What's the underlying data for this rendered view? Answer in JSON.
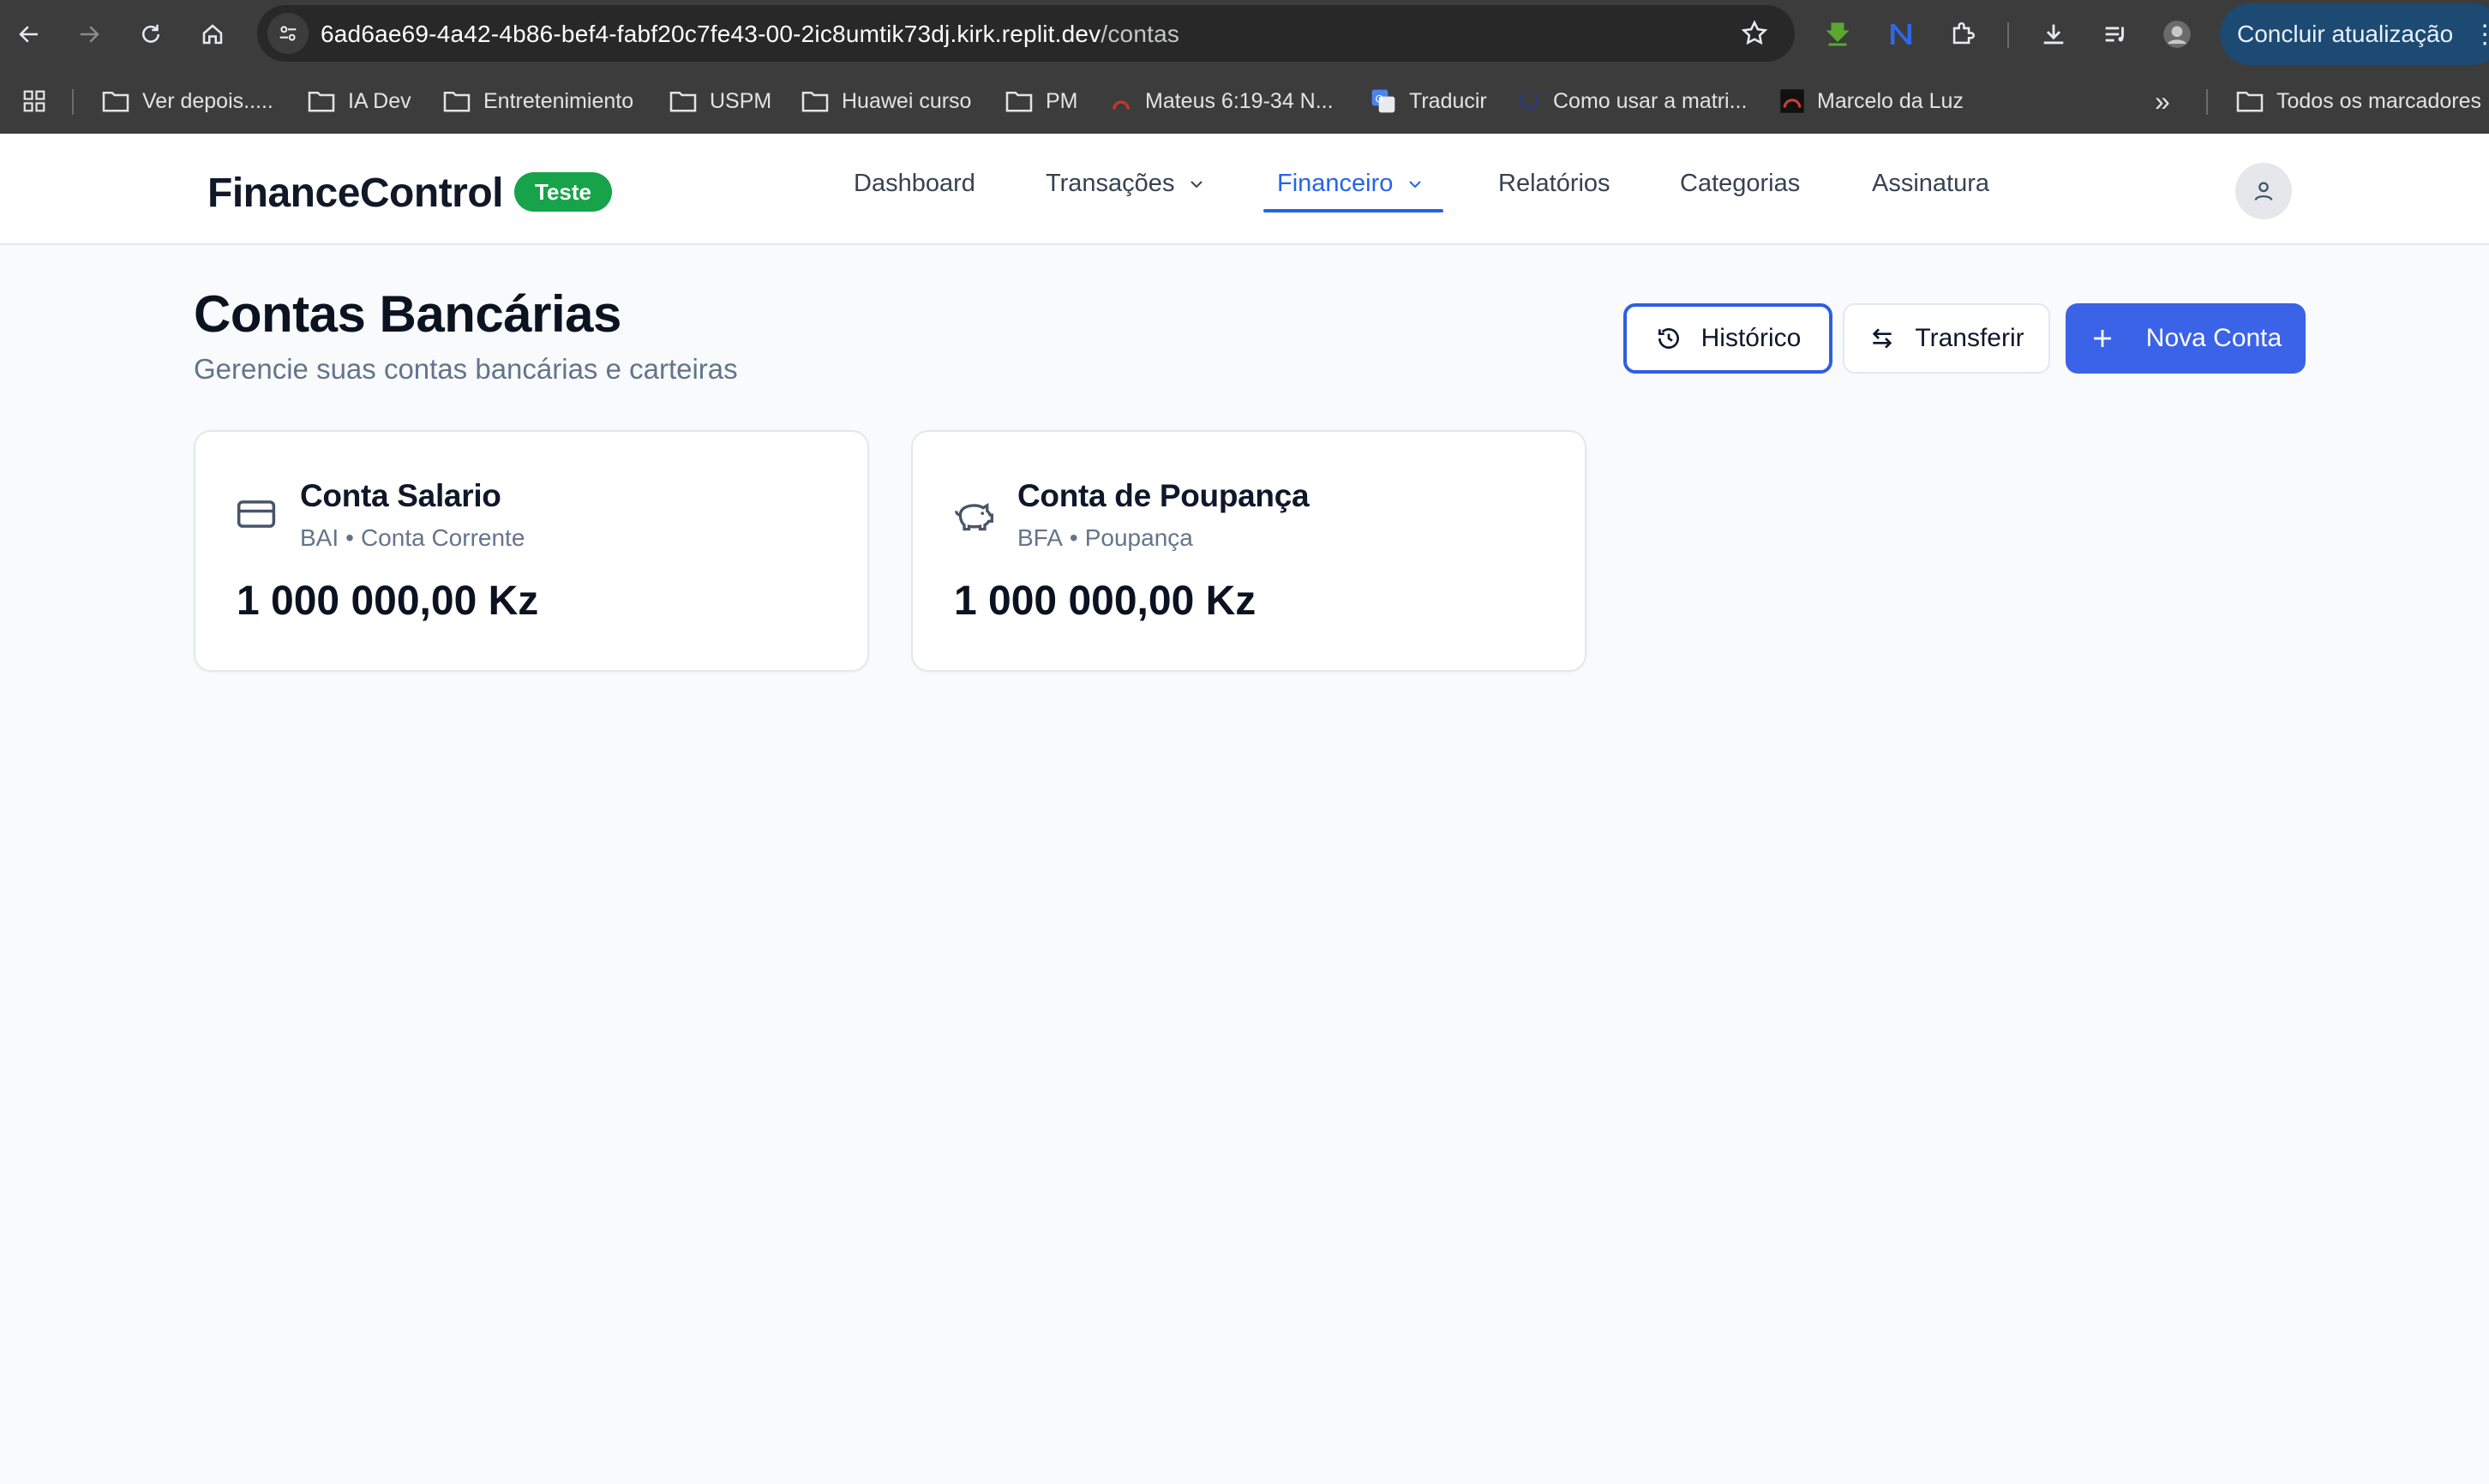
{
  "browser": {
    "url_host": "6ad6ae69-4a42-4b86-bef4-fabf20c7fe43-00-2ic8umtik73dj.kirk.replit.dev",
    "url_path": "/contas",
    "update_button": "Concluir atualização",
    "bookmarks": [
      {
        "label": "Ver depois.....",
        "icon": "folder-icon"
      },
      {
        "label": "IA Dev",
        "icon": "folder-icon"
      },
      {
        "label": "Entretenimiento",
        "icon": "folder-icon"
      },
      {
        "label": "USPM",
        "icon": "folder-icon"
      },
      {
        "label": "Huawei curso",
        "icon": "folder-icon"
      },
      {
        "label": "PM",
        "icon": "folder-icon"
      },
      {
        "label": "Mateus 6:19-34 N...",
        "icon": "site-icon"
      },
      {
        "label": "Traducir",
        "icon": "translate-icon"
      },
      {
        "label": "Como usar a matri...",
        "icon": "site-icon"
      },
      {
        "label": "Marcelo da Luz",
        "icon": "site-icon"
      }
    ],
    "all_bookmarks": "Todos os marcadores"
  },
  "header": {
    "logo": "FinanceControl",
    "badge": "Teste",
    "nav": {
      "dashboard": "Dashboard",
      "transacoes": "Transações",
      "financeiro": "Financeiro",
      "relatorios": "Relatórios",
      "categorias": "Categorias",
      "assinatura": "Assinatura"
    },
    "active_nav": "Financeiro"
  },
  "page": {
    "title": "Contas Bancárias",
    "subtitle": "Gerencie suas contas bancárias e carteiras",
    "buttons": {
      "history": "Histórico",
      "transfer": "Transferir",
      "new_account": "Nova Conta"
    }
  },
  "accounts": [
    {
      "name": "Conta Salario",
      "bank": "BAI",
      "type": "Conta Corrente",
      "balance": "1 000 000,00 Kz",
      "icon": "credit-card-icon"
    },
    {
      "name": "Conta de Poupança",
      "bank": "BFA",
      "type": "Poupança",
      "balance": "1 000 000,00 Kz",
      "icon": "piggy-bank-icon"
    }
  ],
  "colors": {
    "accent": "#2563eb",
    "badge": "#16a34a",
    "primary_button": "#3b63e8"
  }
}
